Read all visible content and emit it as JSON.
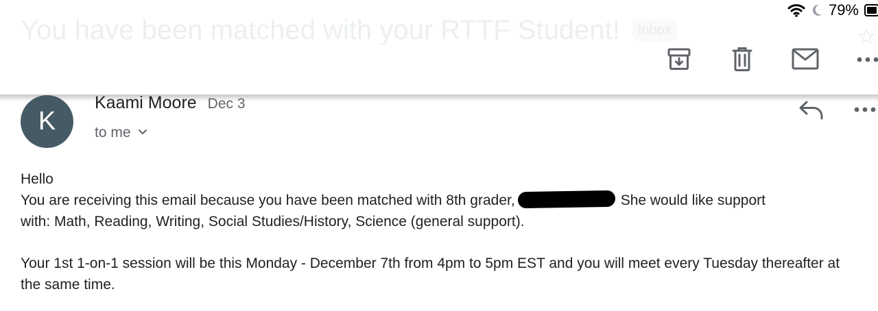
{
  "status_bar": {
    "battery_percent": "79%",
    "wifi_icon": "wifi-icon",
    "focus_icon": "moon-icon",
    "battery_icon": "battery-icon"
  },
  "subject": {
    "title": "You have been matched with your RTTF Student!",
    "label_chip": "Inbox"
  },
  "toolbar": {
    "archive_icon": "archive-icon",
    "delete_icon": "trash-icon",
    "mark_unread_icon": "envelope-icon",
    "more_icon": "more-horizontal-icon"
  },
  "message": {
    "avatar_initial": "K",
    "sender_name": "Kaami Moore",
    "date": "Dec 3",
    "recipient": "to me",
    "reply_icon": "reply-icon",
    "more_icon": "more-horizontal-icon",
    "body": {
      "greeting": "Hello",
      "para1_before_redaction": "You are receiving this email because you have been matched with 8th grader,",
      "para1_after_redaction": "She would like support",
      "para1_line2": "with: Math, Reading, Writing, Social Studies/History, Science (general support).",
      "para2": "Your 1st 1-on-1 session will be this Monday - December 7th from 4pm to 5pm EST and you will meet every Tuesday thereafter at the same time."
    }
  },
  "colors": {
    "avatar_bg": "#455a64",
    "text_primary": "#202124",
    "text_secondary": "#5f6368",
    "icon_gray": "#5f6368"
  }
}
